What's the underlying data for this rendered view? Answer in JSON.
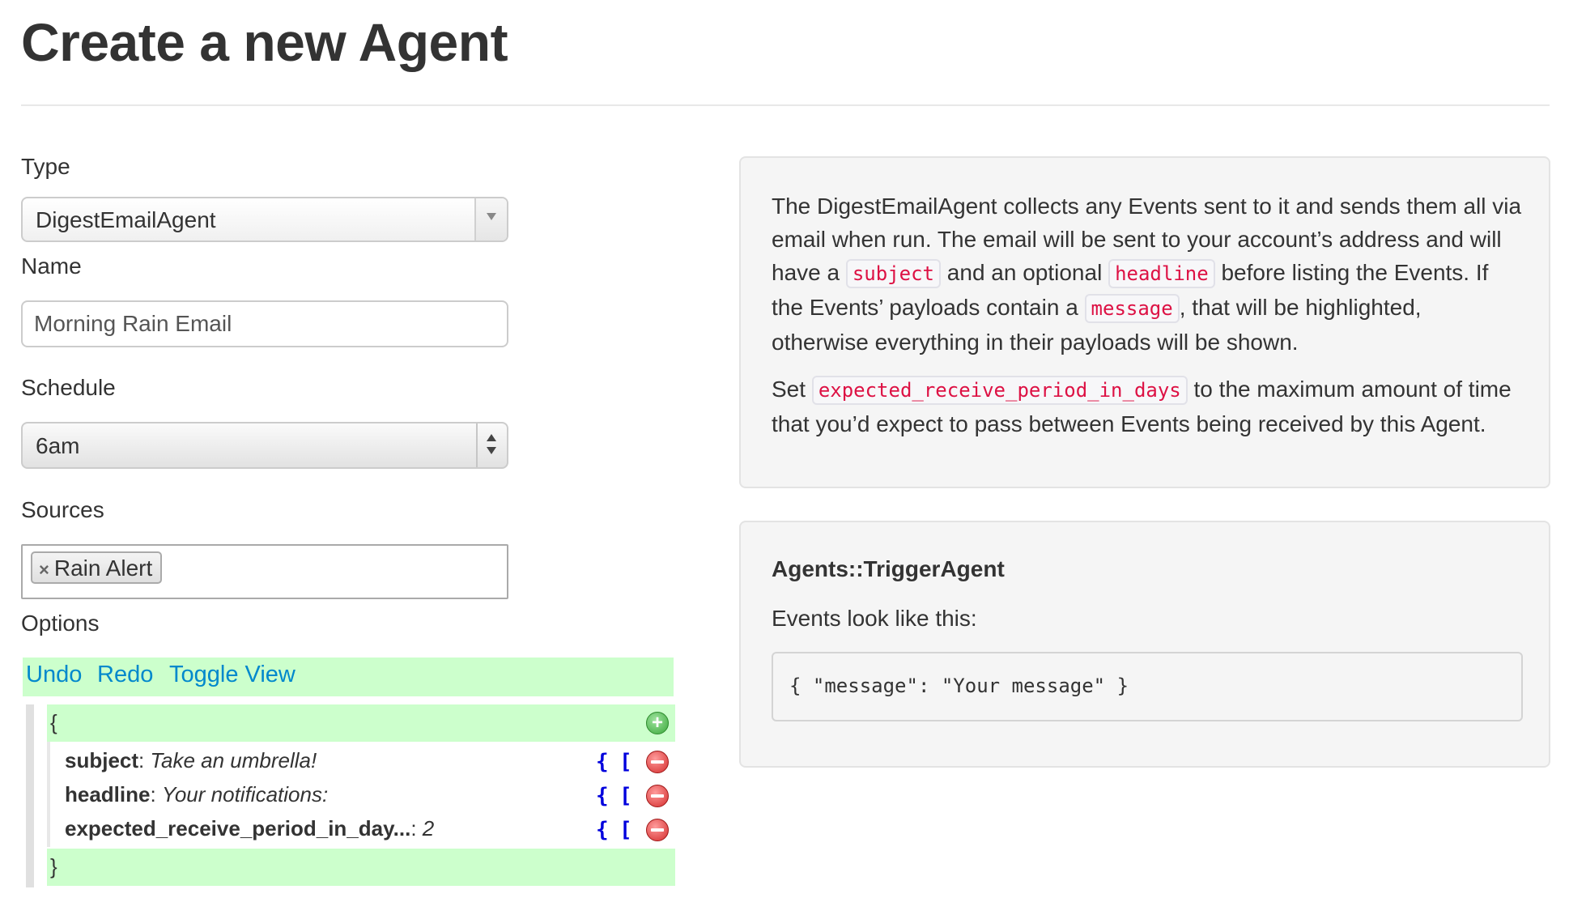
{
  "page": {
    "title": "Create a new Agent"
  },
  "form": {
    "type_label": "Type",
    "type_value": "DigestEmailAgent",
    "name_label": "Name",
    "name_value": "Morning Rain Email",
    "schedule_label": "Schedule",
    "schedule_value": "6am",
    "sources_label": "Sources",
    "sources": [
      {
        "remove": "×",
        "label": "Rain Alert"
      }
    ],
    "options_label": "Options"
  },
  "editor": {
    "toolbar": {
      "undo": "Undo",
      "redo": "Redo",
      "toggle_view": "Toggle View"
    },
    "open_brace": "{",
    "close_brace": "}",
    "add_icon": "+",
    "object_button": "{",
    "array_button": "[",
    "rows": [
      {
        "key": "subject",
        "sep": ": ",
        "value": "Take an umbrella!"
      },
      {
        "key": "headline",
        "sep": ": ",
        "value": "Your notifications:"
      },
      {
        "key": "expected_receive_period_in_day...",
        "sep": ": ",
        "value": "2"
      }
    ]
  },
  "description": {
    "p1": {
      "t1": "The DigestEmailAgent collects any Events sent to it and sends them all via email when run. The email will be sent to your account’s address and will have a ",
      "c1": "subject",
      "t2": " and an optional ",
      "c2": "headline",
      "t3": " before listing the Events. If the Events’ payloads contain a ",
      "c3": "message",
      "t4": ", that will be highlighted, otherwise everything in their payloads will be shown."
    },
    "p2": {
      "t1": "Set ",
      "c1": "expected_receive_period_in_days",
      "t2": " to the maximum amount of time that you’d expect to pass between Events being received by this Agent."
    }
  },
  "event_info": {
    "title": "Agents::TriggerAgent",
    "subtitle": "Events look like this:",
    "sample": "{ \"message\": \"Your message\" }"
  },
  "colors": {
    "editor_highlight": "#ccffcc",
    "link": "#0088cc",
    "code_text": "#dd1144",
    "add_icon": "#3aa83a",
    "remove_icon": "#d42c2c"
  },
  "icons": {
    "type_select": "chevron-down-icon",
    "schedule_select": "up-down-arrows-icon",
    "source_tag_remove": "close-icon",
    "editor_add": "plus-circle-icon",
    "editor_remove": "minus-circle-icon"
  }
}
